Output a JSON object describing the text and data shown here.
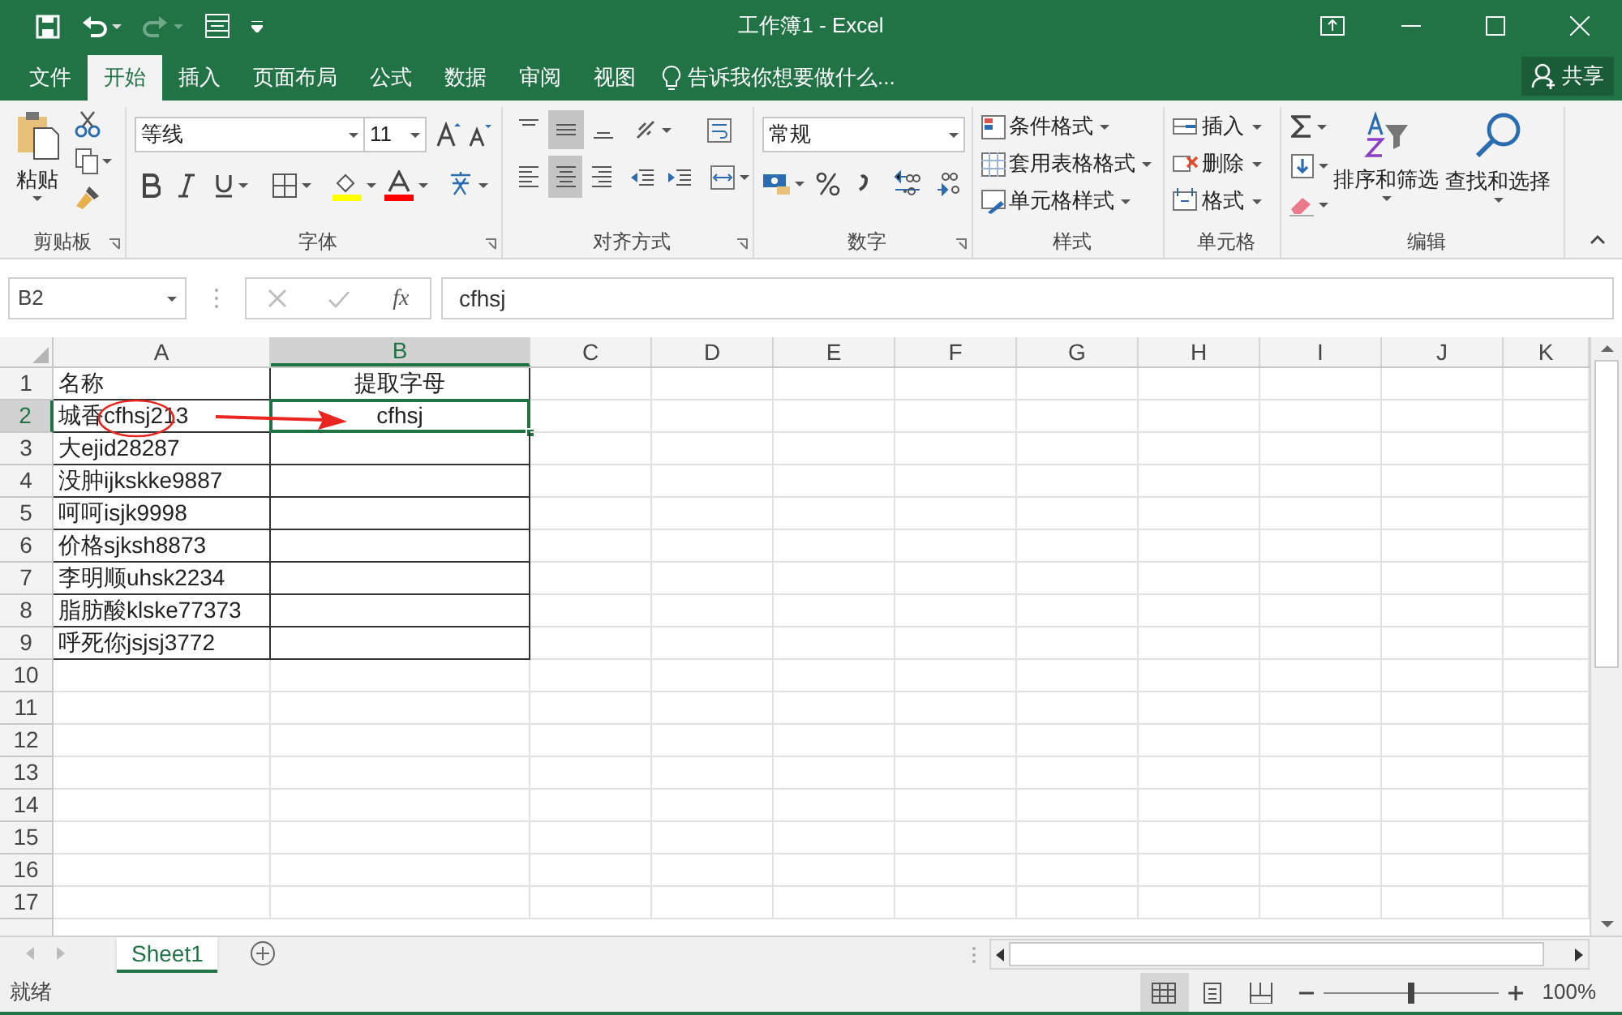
{
  "window": {
    "title": "工作簿1 - Excel"
  },
  "tabs": [
    {
      "label": "文件",
      "selected": false
    },
    {
      "label": "开始",
      "selected": true
    },
    {
      "label": "插入",
      "selected": false
    },
    {
      "label": "页面布局",
      "selected": false
    },
    {
      "label": "公式",
      "selected": false
    },
    {
      "label": "数据",
      "selected": false
    },
    {
      "label": "审阅",
      "selected": false
    },
    {
      "label": "视图",
      "selected": false
    }
  ],
  "tell_me": {
    "text": "告诉我你想要做什么..."
  },
  "share": {
    "label": "共享"
  },
  "ribbon": {
    "clipboard": {
      "paste_label": "粘贴",
      "label": "剪贴板"
    },
    "font": {
      "font_name": "等线",
      "font_size": "11",
      "label": "字体"
    },
    "alignment": {
      "vertical": [
        {
          "kind": "top",
          "selected": false
        },
        {
          "kind": "middle",
          "selected": true
        },
        {
          "kind": "bottom",
          "selected": false
        }
      ],
      "horizontal": [
        {
          "kind": "left",
          "selected": false
        },
        {
          "kind": "center",
          "selected": true
        },
        {
          "kind": "right",
          "selected": false
        }
      ],
      "label": "对齐方式"
    },
    "number": {
      "format": "常规",
      "label": "数字"
    },
    "styles": {
      "items": [
        "条件格式",
        "套用表格格式",
        "单元格样式"
      ],
      "label": "样式"
    },
    "cells": {
      "items": [
        "插入",
        "删除",
        "格式"
      ],
      "label": "单元格"
    },
    "editing": {
      "items": [
        "排序和筛选",
        "查找和选择"
      ],
      "label": "编辑"
    }
  },
  "formula_bar": {
    "name_box": "B2",
    "function_label": "fx",
    "formula": "cfhsj"
  },
  "sheet": {
    "columns": [
      {
        "label": "A",
        "selected": false
      },
      {
        "label": "B",
        "selected": true
      },
      {
        "label": "C",
        "selected": false
      },
      {
        "label": "D",
        "selected": false
      },
      {
        "label": "E",
        "selected": false
      },
      {
        "label": "F",
        "selected": false
      },
      {
        "label": "G",
        "selected": false
      },
      {
        "label": "H",
        "selected": false
      },
      {
        "label": "I",
        "selected": false
      },
      {
        "label": "J",
        "selected": false
      },
      {
        "label": "K",
        "selected": false
      }
    ],
    "rows": [
      {
        "number": "1",
        "selected": false,
        "cells": [
          "名称",
          "提取字母"
        ]
      },
      {
        "number": "2",
        "selected": true,
        "cells": [
          "城香cfhsj213",
          "cfhsj"
        ]
      },
      {
        "number": "3",
        "selected": false,
        "cells": [
          "大ejid28287"
        ]
      },
      {
        "number": "4",
        "selected": false,
        "cells": [
          "没肿ijkskke9887"
        ]
      },
      {
        "number": "5",
        "selected": false,
        "cells": [
          "呵呵isjk9998"
        ]
      },
      {
        "number": "6",
        "selected": false,
        "cells": [
          "价格sjksh8873"
        ]
      },
      {
        "number": "7",
        "selected": false,
        "cells": [
          "李明顺uhsk2234"
        ]
      },
      {
        "number": "8",
        "selected": false,
        "cells": [
          "脂肪酸klske77373"
        ]
      },
      {
        "number": "9",
        "selected": false,
        "cells": [
          "呼死你jsjsj3772"
        ]
      },
      {
        "number": "10",
        "selected": false
      },
      {
        "number": "11",
        "selected": false
      },
      {
        "number": "12",
        "selected": false
      },
      {
        "number": "13",
        "selected": false
      },
      {
        "number": "14",
        "selected": false
      },
      {
        "number": "15",
        "selected": false
      },
      {
        "number": "16",
        "selected": false
      },
      {
        "number": "17",
        "selected": false
      }
    ]
  },
  "sheet_tabs": [
    {
      "label": "Sheet1",
      "selected": true
    }
  ],
  "status_bar": {
    "status": "就绪",
    "views": [
      {
        "kind": "normal",
        "selected": true
      },
      {
        "kind": "page_layout",
        "selected": false
      },
      {
        "kind": "page_break",
        "selected": false
      }
    ],
    "zoom": {
      "level": 0.5,
      "reading": "100%"
    }
  }
}
